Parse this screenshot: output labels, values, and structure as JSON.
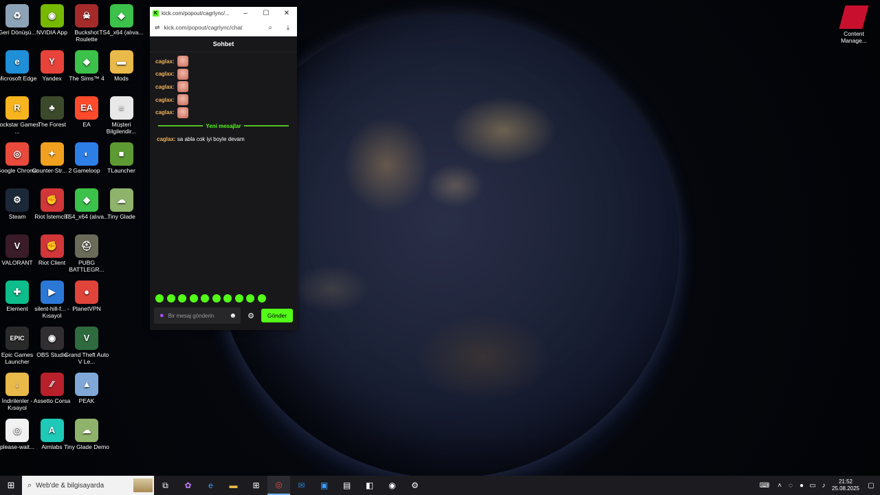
{
  "desktop": {
    "icons": [
      {
        "label": "Geri Dönüşü...",
        "icon": "recycle-bin-icon",
        "color": "#8da3b8",
        "glyph": "♻",
        "col": 0,
        "row": 0
      },
      {
        "label": "NVIDIA App",
        "icon": "nvidia-icon",
        "color": "#76b900",
        "glyph": "◉",
        "col": 1,
        "row": 0
      },
      {
        "label": "Buckshot Roulette",
        "icon": "buckshot-icon",
        "color": "#a52a2a",
        "glyph": "☠",
        "col": 2,
        "row": 0
      },
      {
        "label": "TS4_x64 (alıva...",
        "icon": "sims-plumbob-icon",
        "color": "#3cc14a",
        "glyph": "◆",
        "col": 3,
        "row": 0
      },
      {
        "label": "Microsoft Edge",
        "icon": "edge-icon",
        "color": "#1f8fd8",
        "glyph": "e",
        "col": 0,
        "row": 1
      },
      {
        "label": "Yandex",
        "icon": "yandex-icon",
        "color": "#e8433a",
        "glyph": "Y",
        "col": 1,
        "row": 1
      },
      {
        "label": "The Sims™ 4",
        "icon": "sims-plumbob-icon",
        "color": "#3cc14a",
        "glyph": "◆",
        "col": 2,
        "row": 1
      },
      {
        "label": "Mods",
        "icon": "folder-icon",
        "color": "#e9b949",
        "glyph": "▬",
        "col": 3,
        "row": 1
      },
      {
        "label": "Rockstar Games ...",
        "icon": "rockstar-icon",
        "color": "#f6b51e",
        "glyph": "R",
        "col": 0,
        "row": 2
      },
      {
        "label": "The Forest",
        "icon": "the-forest-icon",
        "color": "#3c4a2c",
        "glyph": "♣",
        "col": 1,
        "row": 2
      },
      {
        "label": "EA",
        "icon": "ea-icon",
        "color": "#ff4b2b",
        "glyph": "EA",
        "col": 2,
        "row": 2
      },
      {
        "label": "Müşteri Bilgilendir...",
        "icon": "document-icon",
        "color": "#e8e8e8",
        "glyph": "≡",
        "col": 3,
        "row": 2
      },
      {
        "label": "Google Chrome",
        "icon": "chrome-icon",
        "color": "#e84a3c",
        "glyph": "◎",
        "col": 0,
        "row": 3
      },
      {
        "label": "Counter-Str... 2",
        "icon": "counter-strike-icon",
        "color": "#f1a11f",
        "glyph": "✦",
        "col": 1,
        "row": 3
      },
      {
        "label": "Gameloop",
        "icon": "gameloop-icon",
        "color": "#2e7ee8",
        "glyph": "◐",
        "col": 2,
        "row": 3
      },
      {
        "label": "TLauncher",
        "icon": "minecraft-grass-icon",
        "color": "#5e9a33",
        "glyph": "■",
        "col": 3,
        "row": 3
      },
      {
        "label": "Steam",
        "icon": "steam-icon",
        "color": "#1b2838",
        "glyph": "⚙",
        "col": 0,
        "row": 4
      },
      {
        "label": "Riot İstemcisi",
        "icon": "riot-icon",
        "color": "#d13639",
        "glyph": "✊",
        "col": 1,
        "row": 4
      },
      {
        "label": "TS4_x64 (alıva...",
        "icon": "sims-plumbob-icon",
        "color": "#3cc14a",
        "glyph": "◆",
        "col": 2,
        "row": 4
      },
      {
        "label": "Tiny Glade",
        "icon": "tiny-glade-icon",
        "color": "#8fb36b",
        "glyph": "☁",
        "col": 3,
        "row": 4
      },
      {
        "label": "VALORANT",
        "icon": "valorant-icon",
        "color": "#3a1b28",
        "glyph": "V",
        "col": 0,
        "row": 5
      },
      {
        "label": "Riot Client",
        "icon": "riot-icon",
        "color": "#d13639",
        "glyph": "✊",
        "col": 1,
        "row": 5
      },
      {
        "label": "PUBG BATTLEGR...",
        "icon": "pubg-icon",
        "color": "#6b6b5a",
        "glyph": "⛑",
        "col": 2,
        "row": 5
      },
      {
        "label": "Element",
        "icon": "element-icon",
        "color": "#0dbd8b",
        "glyph": "✚",
        "col": 0,
        "row": 6
      },
      {
        "label": "silent-hill-f... - Kısayol",
        "icon": "video-file-icon",
        "color": "#2b78d6",
        "glyph": "▶",
        "col": 1,
        "row": 6
      },
      {
        "label": "PlanetVPN",
        "icon": "planetvpn-icon",
        "color": "#e0443a",
        "glyph": "●",
        "col": 2,
        "row": 6
      },
      {
        "label": "Epic Games Launcher",
        "icon": "epic-games-icon",
        "color": "#2a2a2a",
        "glyph": "EPIC",
        "col": 0,
        "row": 7
      },
      {
        "label": "OBS Studio",
        "icon": "obs-icon",
        "color": "#302e31",
        "glyph": "◉",
        "col": 1,
        "row": 7
      },
      {
        "label": "Grand Theft Auto V Le...",
        "icon": "gta-v-icon",
        "color": "#2e6b3e",
        "glyph": "V",
        "col": 2,
        "row": 7
      },
      {
        "label": "İndirilenler - Kısayol",
        "icon": "downloads-folder-icon",
        "color": "#e9b949",
        "glyph": "↓",
        "col": 0,
        "row": 8
      },
      {
        "label": "Assetto Corsa",
        "icon": "assetto-corsa-icon",
        "color": "#b8202b",
        "glyph": "⁄⁄",
        "col": 1,
        "row": 8
      },
      {
        "label": "PEAK",
        "icon": "peak-icon",
        "color": "#7fa8d8",
        "glyph": "▲",
        "col": 2,
        "row": 8
      },
      {
        "label": "please-wait...",
        "icon": "chrome-file-icon",
        "color": "#f2f2f2",
        "glyph": "◎",
        "col": 0,
        "row": 9
      },
      {
        "label": "Aimlabs",
        "icon": "aimlabs-icon",
        "color": "#1ec9b8",
        "glyph": "A",
        "col": 1,
        "row": 9
      },
      {
        "label": "Tiny Glade Demo",
        "icon": "tiny-glade-icon",
        "color": "#8fb36b",
        "glyph": "☁",
        "col": 2,
        "row": 9
      }
    ],
    "right_icon": {
      "label": "Content Manage...",
      "icon": "content-manager-icon"
    }
  },
  "window": {
    "title": "kick.com/popout/cagrlync/...",
    "address": "kick.com/popout/cagrlync/chat",
    "minimize": "–",
    "maximize": "☐",
    "close": "✕"
  },
  "chat": {
    "header": "Sohbet",
    "messages": [
      {
        "user": "caglax:"
      },
      {
        "user": "caglax:"
      },
      {
        "user": "caglax:"
      },
      {
        "user": "caglax:"
      },
      {
        "user": "caglax:"
      }
    ],
    "new_messages_label": "Yeni mesajlar",
    "latest": {
      "user": "caglax:",
      "text": " sa abla cok iyi boyle devam"
    },
    "input_placeholder": "Bir mesaj gönderin",
    "send_label": "Gönder",
    "accent": "#53fc18"
  },
  "taskbar": {
    "search_placeholder": "Web'de & bilgisayarda",
    "time": "21:52",
    "date": "25.08.2025"
  }
}
